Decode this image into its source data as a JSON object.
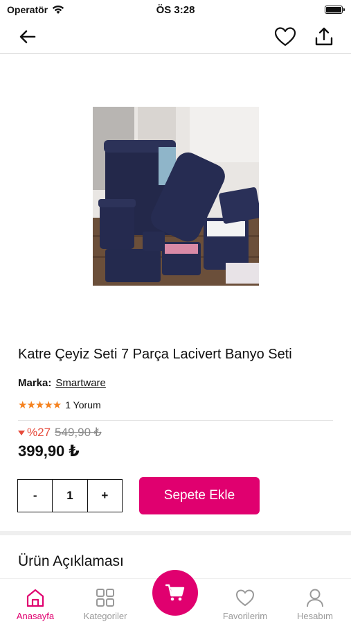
{
  "status_bar": {
    "carrier": "Operatör",
    "time": "ÖS 3:28"
  },
  "product": {
    "title": "Katre Çeyiz Seti 7 Parça Lacivert Banyo Seti",
    "brand_label": "Marka:",
    "brand_value": "Smartware",
    "stars": "★★★★★",
    "rating": 5,
    "reviews": "1 Yorum",
    "discount": "%27",
    "old_price": "549,90 ₺",
    "price": "399,90 ₺"
  },
  "quantity": {
    "minus": "-",
    "value": "1",
    "plus": "+"
  },
  "add_to_cart": "Sepete Ekle",
  "description_title": "Ürün Açıklaması",
  "tabs": [
    {
      "label": "Anasayfa",
      "icon": "home-icon"
    },
    {
      "label": "Kategoriler",
      "icon": "grid-icon"
    },
    {
      "label": "Favorilerim",
      "icon": "heart-icon"
    },
    {
      "label": "Hesabım",
      "icon": "user-icon"
    }
  ],
  "colors": {
    "accent": "#e0006f",
    "discount": "#e64a3b",
    "star": "#f5821f"
  }
}
